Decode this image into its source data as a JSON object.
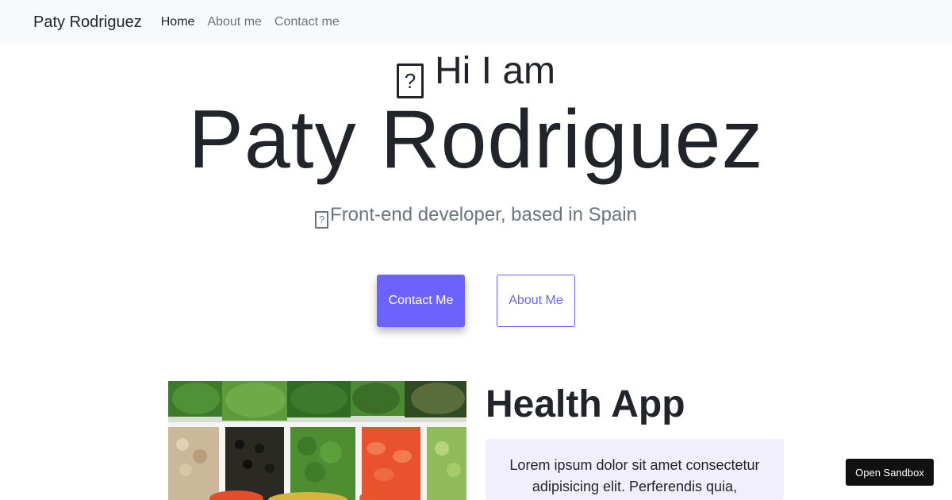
{
  "navbar": {
    "brand": "Paty Rodriguez",
    "links": [
      {
        "label": "Home",
        "active": true
      },
      {
        "label": "About me",
        "active": false
      },
      {
        "label": "Contact me",
        "active": false
      }
    ]
  },
  "hero": {
    "emoji_glyph": "?",
    "greeting": "Hi I am",
    "name": "Paty Rodriguez",
    "tagline_glyph": "?",
    "tagline": "Front-end developer, based in Spain",
    "primary_button": "Contact Me",
    "secondary_button": "About Me"
  },
  "project": {
    "image_icon": "vegetables-photo",
    "title": "Health App",
    "description": "Lorem ipsum dolor sit amet consectetur adipisicing elit. Perferendis quia,"
  },
  "sandbox_button": "Open Sandbox",
  "colors": {
    "accent": "#6c63ff",
    "navbar_bg": "#f8f9fa",
    "description_bg": "#f1effd"
  }
}
